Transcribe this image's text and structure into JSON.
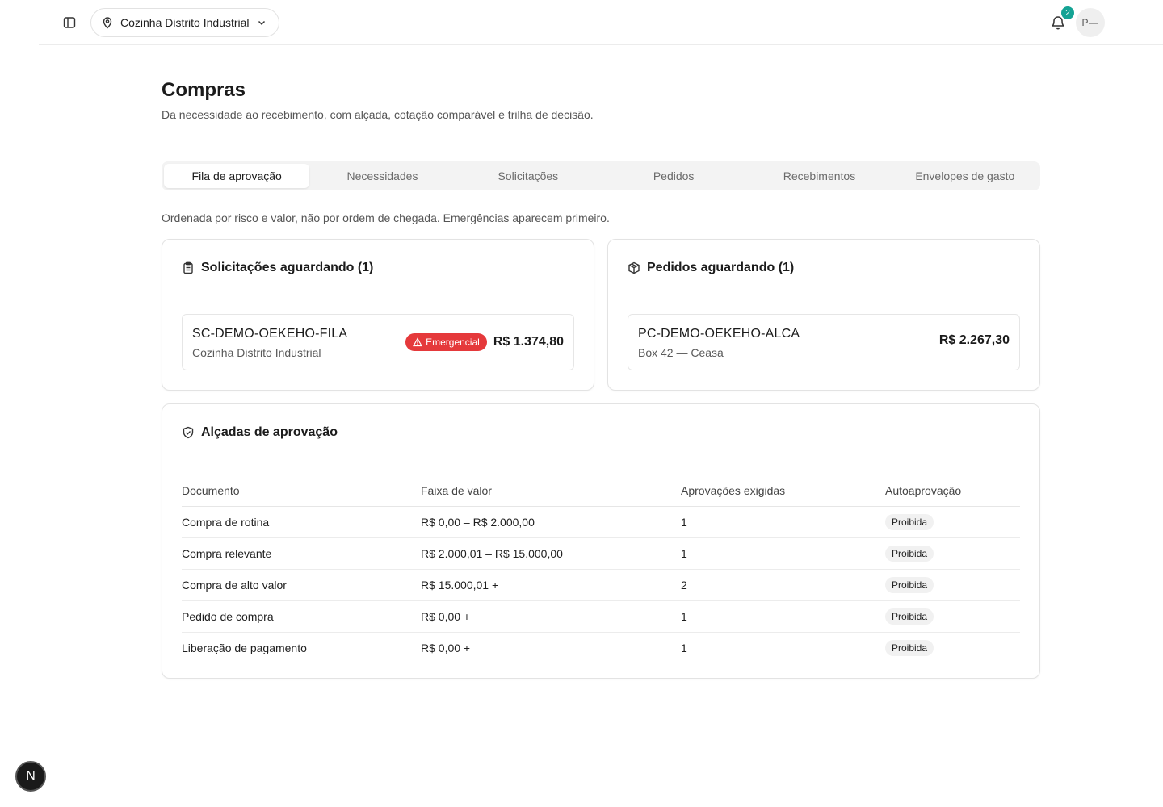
{
  "header": {
    "location": "Cozinha Distrito Industrial",
    "notifications_count": "2",
    "avatar_initials": "P—"
  },
  "page": {
    "title": "Compras",
    "subtitle": "Da necessidade ao recebimento, com alçada, cotação comparável e trilha de decisão."
  },
  "tabs": [
    {
      "label": "Fila de aprovação",
      "active": true
    },
    {
      "label": "Necessidades",
      "active": false
    },
    {
      "label": "Solicitações",
      "active": false
    },
    {
      "label": "Pedidos",
      "active": false
    },
    {
      "label": "Recebimentos",
      "active": false
    },
    {
      "label": "Envelopes de gasto",
      "active": false
    }
  ],
  "queue_note": "Ordenada por risco e valor, não por ordem de chegada. Emergências aparecem primeiro.",
  "requests_card": {
    "title": "Solicitações aguardando (1)",
    "item": {
      "code": "SC-DEMO-OEKEHO-FILA",
      "location": "Cozinha Distrito Industrial",
      "badge": "Emergencial",
      "amount": "R$ 1.374,80"
    }
  },
  "orders_card": {
    "title": "Pedidos aguardando (1)",
    "item": {
      "code": "PC-DEMO-OEKEHO-ALCA",
      "supplier": "Box 42 — Ceasa",
      "amount": "R$ 2.267,30"
    }
  },
  "alcadas": {
    "title": "Alçadas de aprovação",
    "columns": [
      "Documento",
      "Faixa de valor",
      "Aprovações exigidas",
      "Autoaprovação"
    ],
    "rows": [
      {
        "document": "Compra de rotina",
        "range": "R$ 0,00 – R$ 2.000,00",
        "approvals": "1",
        "auto": "Proibida"
      },
      {
        "document": "Compra relevante",
        "range": "R$ 2.000,01 – R$ 15.000,00",
        "approvals": "1",
        "auto": "Proibida"
      },
      {
        "document": "Compra de alto valor",
        "range": "R$ 15.000,01 +",
        "approvals": "2",
        "auto": "Proibida"
      },
      {
        "document": "Pedido de compra",
        "range": "R$ 0,00 +",
        "approvals": "1",
        "auto": "Proibida"
      },
      {
        "document": "Liberação de pagamento",
        "range": "R$ 0,00 +",
        "approvals": "1",
        "auto": "Proibida"
      }
    ]
  },
  "dev_button": "N",
  "colors": {
    "accent_teal": "#14a394",
    "emergency_red": "#e5393b"
  },
  "icons": [
    "sidebar-toggle-icon",
    "map-pin-icon",
    "chevron-down-icon",
    "bell-icon",
    "clipboard-icon",
    "package-icon",
    "shield-check-icon",
    "alert-triangle-icon"
  ]
}
